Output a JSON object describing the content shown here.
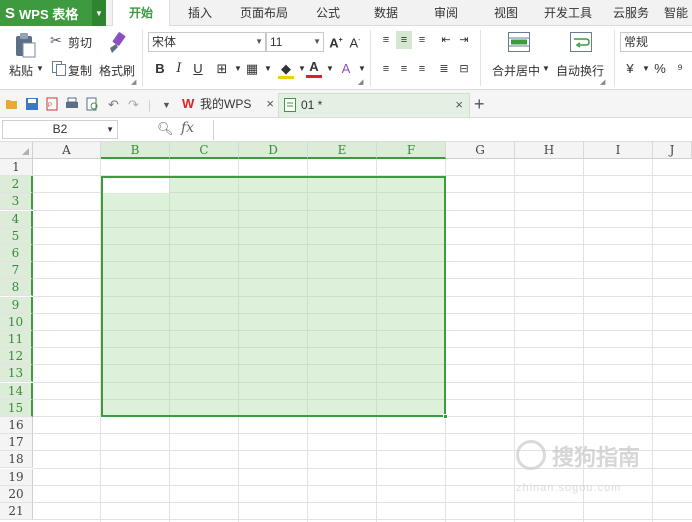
{
  "app": {
    "logo": "S",
    "name": "WPS 表格"
  },
  "menu": [
    "开始",
    "插入",
    "页面布局",
    "公式",
    "数据",
    "审阅",
    "视图",
    "开发工具",
    "云服务",
    "智能"
  ],
  "ribbon": {
    "paste": "粘贴",
    "cut": "剪切",
    "copy": "复制",
    "format_painter": "格式刷",
    "font_name": "宋体",
    "font_size": "11",
    "merge_center": "合并居中",
    "wrap_text": "自动换行",
    "number_format": "常规",
    "percent": "%",
    "comma": "⁹"
  },
  "tabs": {
    "wps_tab": "我的WPS",
    "file_tab": "01 *"
  },
  "formula_bar": {
    "name_box": "B2",
    "fx": "fx",
    "formula": ""
  },
  "sheet": {
    "columns": [
      "A",
      "B",
      "C",
      "D",
      "E",
      "F",
      "G",
      "H",
      "I",
      "J"
    ],
    "rows": [
      "1",
      "2",
      "3",
      "4",
      "5",
      "6",
      "7",
      "8",
      "9",
      "10",
      "11",
      "12",
      "13",
      "14",
      "15",
      "16",
      "17",
      "18",
      "19",
      "20",
      "21"
    ],
    "selection": "B2:F15",
    "selected_columns": [
      "B",
      "C",
      "D",
      "E",
      "F"
    ],
    "selected_rows": [
      "2",
      "3",
      "4",
      "5",
      "6",
      "7",
      "8",
      "9",
      "10",
      "11",
      "12",
      "13",
      "14",
      "15"
    ]
  },
  "watermark": {
    "text": "搜狗指南",
    "url": "zhinan.sogou.com"
  },
  "colors": {
    "accent": "#3e9a3e",
    "selection_fill": "#dcefd6"
  }
}
